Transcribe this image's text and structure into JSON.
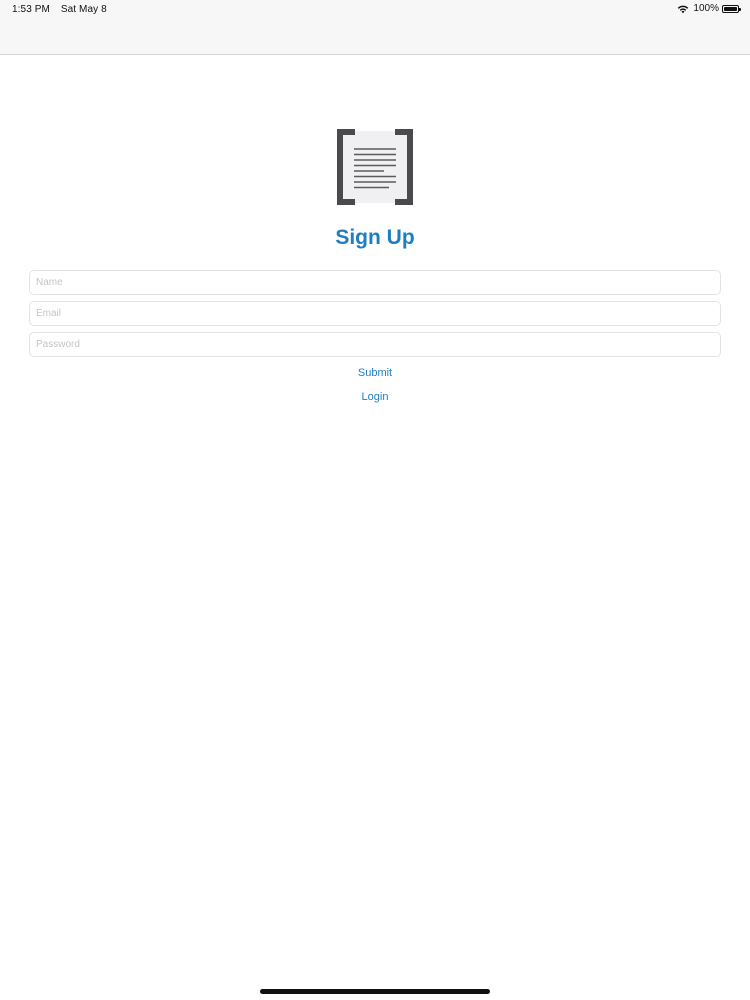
{
  "status_bar": {
    "time": "1:53 PM",
    "date": "Sat May 8",
    "battery_percent": "100%",
    "icons": [
      "wifi-icon",
      "battery-icon"
    ]
  },
  "logo": {
    "icon": "document-brackets-logo"
  },
  "form": {
    "title": "Sign Up",
    "name_placeholder": "Name",
    "email_placeholder": "Email",
    "password_placeholder": "Password",
    "submit_label": "Submit",
    "login_label": "Login"
  },
  "colors": {
    "accent": "#1f7ec1",
    "logo_gray": "#4a4a4e",
    "status_bar_bg": "#f7f7f7"
  }
}
